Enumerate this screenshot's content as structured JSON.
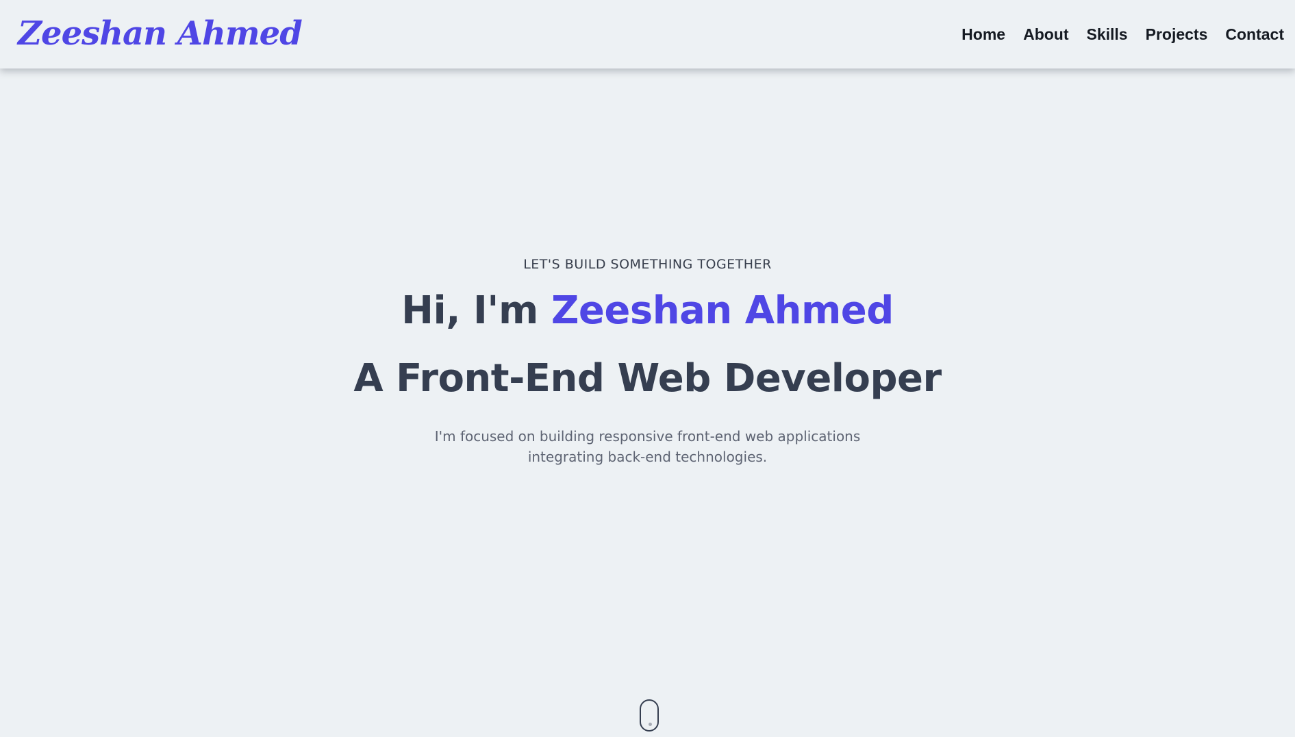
{
  "brand": {
    "name": "Zeeshan Ahmed"
  },
  "nav": {
    "items": [
      "Home",
      "About",
      "Skills",
      "Projects",
      "Contact"
    ]
  },
  "hero": {
    "tagline": "LET'S BUILD SOMETHING TOGETHER",
    "greeting_prefix": "Hi, I'm ",
    "greeting_name": "Zeeshan Ahmed",
    "role": "A Front-End Web Developer",
    "description_line1": "I'm focused on building responsive front-end web applications",
    "description_line2": "integrating back-end technologies."
  },
  "colors": {
    "accent": "#4f46e5",
    "heading": "#353e50",
    "background": "#edf1f4"
  },
  "icons": {
    "scroll_indicator": "mouse-scroll-icon"
  }
}
